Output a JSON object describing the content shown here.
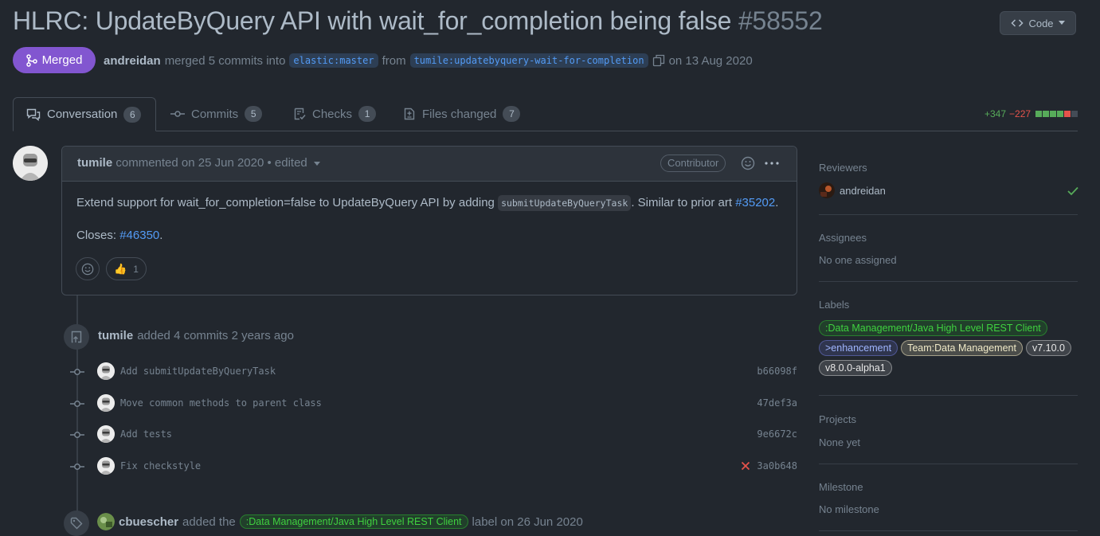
{
  "header": {
    "title": "HLRC: UpdateByQuery API with wait_for_completion being false",
    "number": "#58552",
    "code_button": "Code",
    "status": "Merged",
    "author": "andreidan",
    "merge_text": "merged 5 commits into",
    "base_branch": "elastic:master",
    "from_text": "from",
    "head_branch": "tumile:updatebyquery-wait-for-completion",
    "date_text": "on 13 Aug 2020"
  },
  "tabs": [
    {
      "label": "Conversation",
      "count": "6"
    },
    {
      "label": "Commits",
      "count": "5"
    },
    {
      "label": "Checks",
      "count": "1"
    },
    {
      "label": "Files changed",
      "count": "7"
    }
  ],
  "diffstat": {
    "additions": "+347",
    "deletions": "−227"
  },
  "comment": {
    "author": "tumile",
    "meta": "commented on 25 Jun 2020 • edited",
    "role": "Contributor",
    "body_prefix": "Extend support for wait_for_completion=false to UpdateByQuery API by adding",
    "body_code": "submitUpdateByQueryTask",
    "body_middle": ". Similar to prior art",
    "body_link": "#35202",
    "body_suffix": ".",
    "closes_label": "Closes:",
    "closes_link": "#46350",
    "closes_suffix": ".",
    "reaction_emoji": "👍",
    "reaction_count": "1"
  },
  "commits_event": {
    "author": "tumile",
    "text": "added 4 commits 2 years ago",
    "commits": [
      {
        "message": "Add submitUpdateByQueryTask",
        "sha": "b66098f",
        "failed": false
      },
      {
        "message": "Move common methods to parent class",
        "sha": "47def3a",
        "failed": false
      },
      {
        "message": "Add tests",
        "sha": "9e6672c",
        "failed": false
      },
      {
        "message": "Fix checkstyle",
        "sha": "3a0b648",
        "failed": true
      }
    ]
  },
  "label_event": {
    "author": "cbuescher",
    "before": "added the",
    "label": ":Data Management/Java High Level REST Client",
    "after": "label on 26 Jun 2020"
  },
  "sidebar": {
    "reviewers_title": "Reviewers",
    "reviewer": "andreidan",
    "assignees_title": "Assignees",
    "assignees_value": "No one assigned",
    "labels_title": "Labels",
    "labels": [
      {
        "text": ":Data Management/Java High Level REST Client",
        "color": "#3fd13f",
        "bg": "rgba(33,191,33,0.16)",
        "border": "rgba(50,205,50,0.45)"
      },
      {
        "text": ">enhancement",
        "color": "#a0b6ff",
        "bg": "rgba(110,120,230,0.18)",
        "border": "rgba(120,130,240,0.45)"
      },
      {
        "text": "Team:Data Management",
        "color": "#f0eac8",
        "bg": "rgba(240,230,190,0.20)",
        "border": "rgba(240,230,190,0.55)"
      },
      {
        "text": "v7.10.0",
        "color": "#e6e6e6",
        "bg": "rgba(220,220,220,0.16)",
        "border": "rgba(220,220,220,0.45)"
      },
      {
        "text": "v8.0.0-alpha1",
        "color": "#e6e6e6",
        "bg": "rgba(220,220,220,0.16)",
        "border": "rgba(220,220,220,0.45)"
      }
    ],
    "projects_title": "Projects",
    "projects_value": "None yet",
    "milestone_title": "Milestone",
    "milestone_value": "No milestone"
  }
}
